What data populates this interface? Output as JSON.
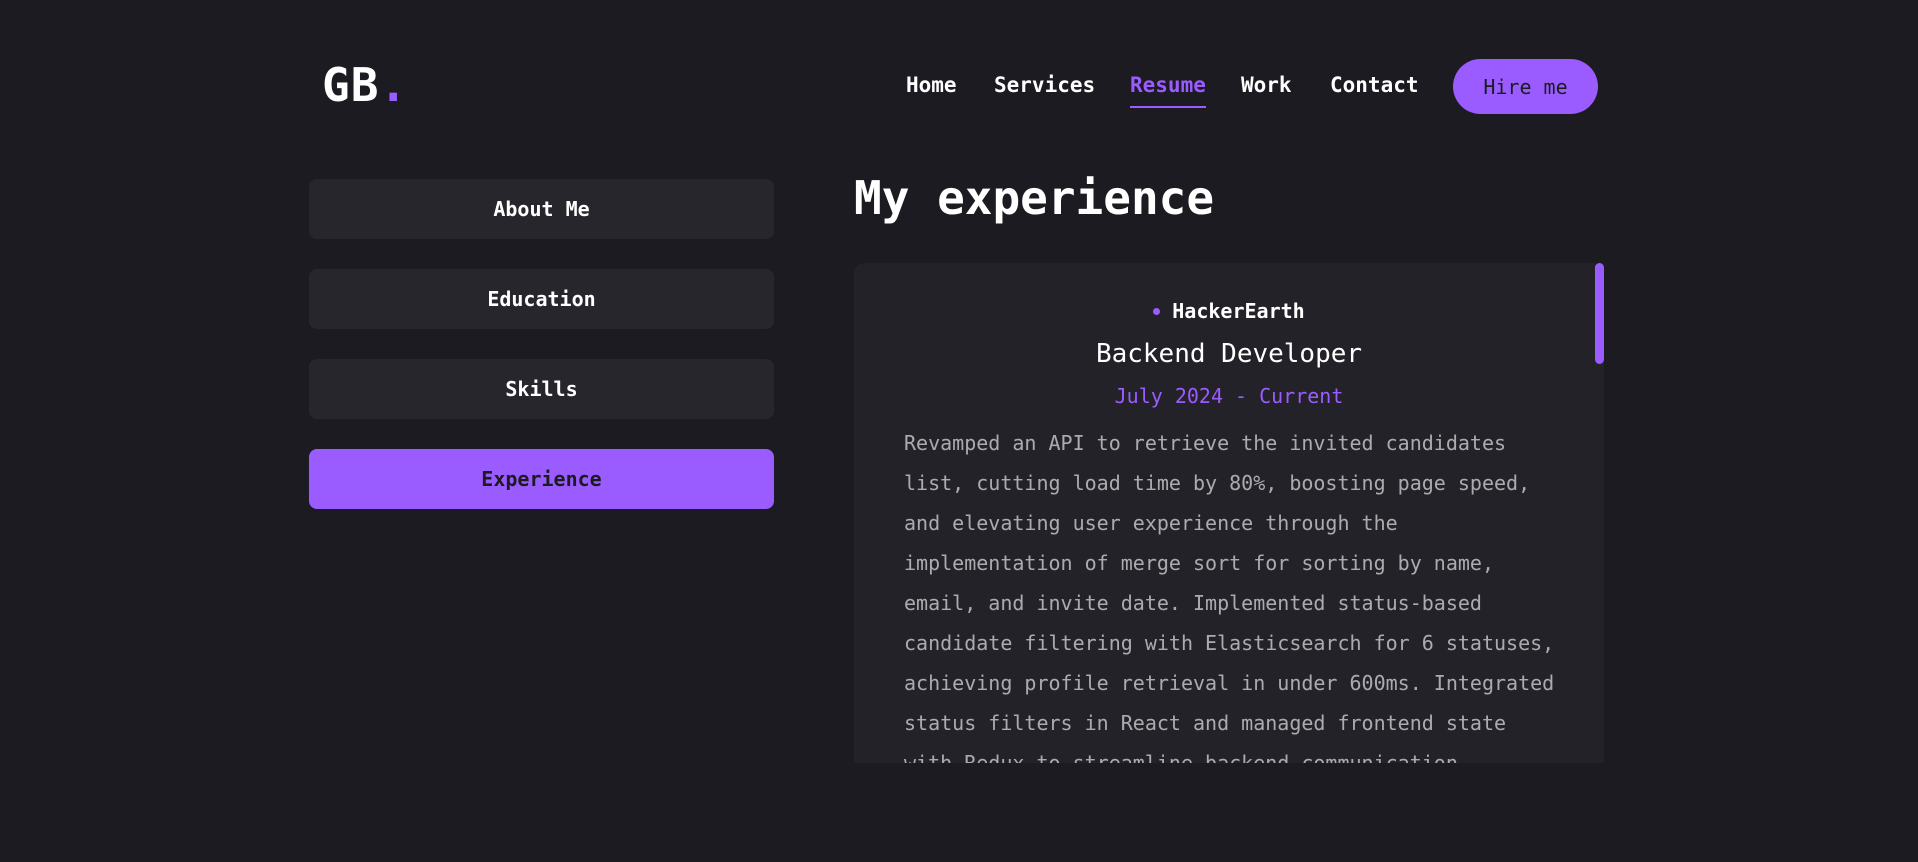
{
  "header": {
    "logo_text": "GB",
    "logo_dot": ".",
    "nav": [
      {
        "label": "Home",
        "active": false
      },
      {
        "label": "Services",
        "active": false
      },
      {
        "label": "Resume",
        "active": true
      },
      {
        "label": "Work",
        "active": false
      },
      {
        "label": "Contact",
        "active": false
      }
    ],
    "hire_label": "Hire me"
  },
  "sidebar": {
    "tabs": [
      {
        "label": "About Me",
        "active": false
      },
      {
        "label": "Education",
        "active": false
      },
      {
        "label": "Skills",
        "active": false
      },
      {
        "label": "Experience",
        "active": true
      }
    ]
  },
  "main": {
    "title": "My experience",
    "experience": {
      "company": "HackerEarth",
      "role": "Backend Developer",
      "dates": "July 2024 - Current",
      "description": "Revamped an API to retrieve the invited candidates list, cutting load time by 80%, boosting page speed, and elevating user experience through the implementation of merge sort for sorting by name, email, and invite date. Implemented status-based candidate filtering with Elasticsearch for 6 statuses, achieving profile retrieval in under 600ms. Integrated status filters in React and managed frontend state with Redux to streamline backend communication."
    }
  },
  "colors": {
    "background": "#1c1b22",
    "accent": "#9b5cff",
    "panel": "#27262d",
    "card": "#232229"
  }
}
